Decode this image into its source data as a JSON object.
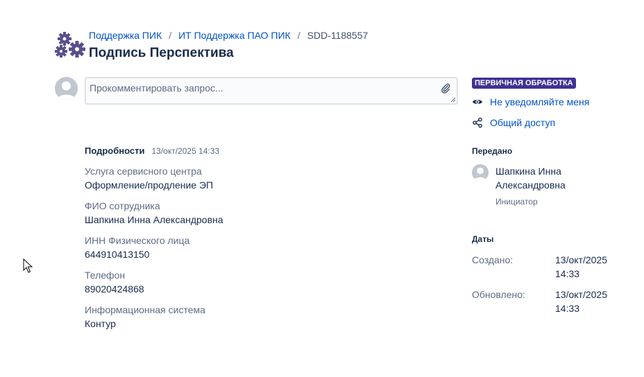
{
  "breadcrumb": {
    "items": [
      "Поддержка ПИК",
      "ИТ Поддержка ПАО ПИК"
    ],
    "separator": "/",
    "current": "SDD-1188557"
  },
  "title": "Подпись Перспектива",
  "comment": {
    "placeholder": "Прокомментировать запрос...",
    "attach_icon": "paperclip-icon"
  },
  "details": {
    "heading": "Подробности",
    "date": "13/окт/2025 14:33",
    "fields": [
      {
        "label": "Услуга сервисного центра",
        "value": "Оформление/продление ЭП"
      },
      {
        "label": "ФИО сотрудника",
        "value": "Шапкина Инна Александровна"
      },
      {
        "label": "ИНН Физического лица",
        "value": "644910413150"
      },
      {
        "label": "Телефон",
        "value": "89020424868"
      },
      {
        "label": "Информационная система",
        "value": "Контур"
      }
    ]
  },
  "sidebar": {
    "status": "ПЕРВИЧНАЯ ОБРАБОТКА",
    "status_color": "#403294",
    "actions": [
      {
        "label": "Не уведомляйте меня",
        "icon": "eye-icon"
      },
      {
        "label": "Общий доступ",
        "icon": "share-icon"
      }
    ],
    "assigned_heading": "Передано",
    "assignee_name": "Шапкина Инна Александровна",
    "assignee_role": "Инициатор",
    "dates_heading": "Даты",
    "created_label": "Создано:",
    "created_value": "13/окт/2025 14:33",
    "updated_label": "Обновлено:",
    "updated_value": "13/окт/2025 14:33"
  },
  "colors": {
    "link": "#0052cc",
    "text": "#172b4d",
    "muted": "#5e6c84",
    "logo": "#5a4e8c"
  }
}
